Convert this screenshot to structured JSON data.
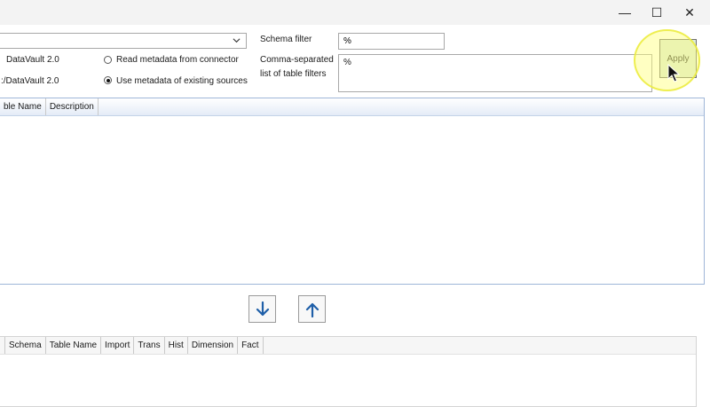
{
  "window": {
    "minimize_glyph": "—",
    "maximize_glyph": "☐",
    "close_glyph": "✕"
  },
  "source": {
    "combo_value": "",
    "path1": "DataVault 2.0",
    "path2": ":/DataVault 2.0"
  },
  "metadata": {
    "option_connector": "Read metadata from connector",
    "option_existing": "Use metadata of existing sources",
    "selected": "existing"
  },
  "filters": {
    "schema_label": "Schema filter",
    "schema_value": "%",
    "table_label_line1": "Comma-separated",
    "table_label_line2": "list of table filters",
    "table_value": "%",
    "apply_label": "Apply"
  },
  "top_grid": {
    "columns": [
      "ble Name",
      "Description"
    ]
  },
  "bottom_grid": {
    "columns": [
      "Schema",
      "Table Name",
      "Import",
      "Trans",
      "Hist",
      "Dimension",
      "Fact"
    ]
  },
  "icons": {
    "move_down": "arrow-down-icon",
    "move_up": "arrow-up-icon",
    "combo": "chevron-down-icon",
    "pointer": "mouse-pointer-icon"
  },
  "colors": {
    "arrow": "#1f5fa8",
    "grid_border": "#9fb6d8",
    "apply_bg": "#dcecdc",
    "highlight": "#ffff78"
  }
}
